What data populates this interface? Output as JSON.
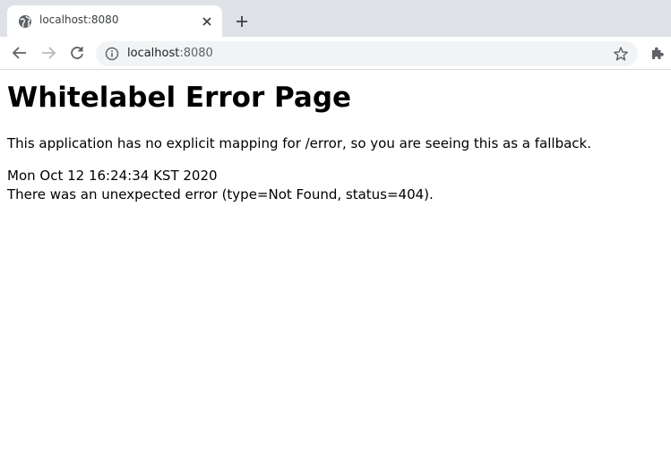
{
  "browser": {
    "tab_title": "localhost:8080",
    "url_host": "localhost",
    "url_port": ":8080"
  },
  "page": {
    "heading": "Whitelabel Error Page",
    "message": "This application has no explicit mapping for /error, so you are seeing this as a fallback.",
    "timestamp": "Mon Oct 12 16:24:34 KST 2020",
    "error_detail": "There was an unexpected error (type=Not Found, status=404)."
  },
  "icons": {
    "favicon": "globe-icon",
    "tab_close": "close-icon",
    "new_tab": "plus-icon",
    "back": "back-arrow-icon",
    "forward": "forward-arrow-icon",
    "reload": "reload-icon",
    "site_info": "info-icon",
    "bookmark": "star-icon",
    "extensions": "puzzle-icon"
  },
  "colors": {
    "tabstrip": "#dee1e6",
    "omnibox": "#f1f3f4",
    "text": "#000000"
  }
}
